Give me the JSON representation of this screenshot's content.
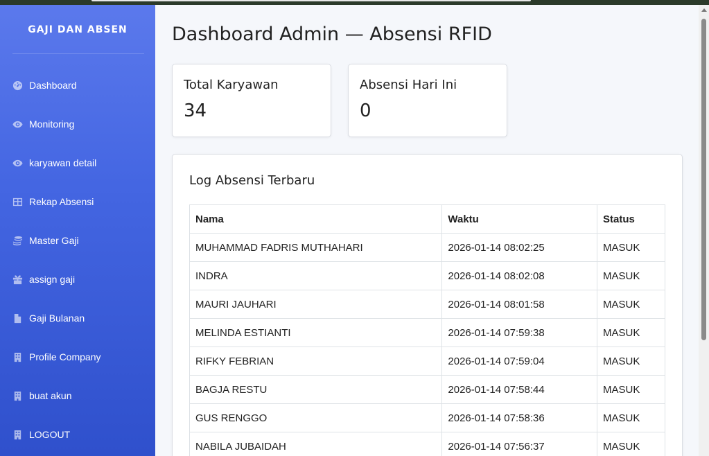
{
  "sidebar": {
    "brand": "GAJI DAN ABSEN",
    "items": [
      {
        "label": "Dashboard",
        "icon": "dashboard-icon"
      },
      {
        "label": "Monitoring",
        "icon": "eye-icon"
      },
      {
        "label": "karyawan detail",
        "icon": "eye-icon"
      },
      {
        "label": "Rekap Absensi",
        "icon": "table-icon"
      },
      {
        "label": "Master Gaji",
        "icon": "coins-icon"
      },
      {
        "label": "assign gaji",
        "icon": "gift-icon"
      },
      {
        "label": "Gaji Bulanan",
        "icon": "file-icon"
      },
      {
        "label": "Profile Company",
        "icon": "building-icon"
      },
      {
        "label": "buat akun",
        "icon": "building-icon"
      },
      {
        "label": "LOGOUT",
        "icon": "building-icon"
      }
    ]
  },
  "main": {
    "title": "Dashboard Admin — Absensi RFID",
    "stats": [
      {
        "label": "Total Karyawan",
        "value": "34"
      },
      {
        "label": "Absensi Hari Ini",
        "value": "0"
      }
    ],
    "log": {
      "title": "Log Absensi Terbaru",
      "columns": [
        "Nama",
        "Waktu",
        "Status"
      ],
      "rows": [
        [
          "MUHAMMAD FADRIS MUTHAHARI",
          "2026-01-14 08:02:25",
          "MASUK"
        ],
        [
          "INDRA",
          "2026-01-14 08:02:08",
          "MASUK"
        ],
        [
          "MAURI JAUHARI",
          "2026-01-14 08:01:58",
          "MASUK"
        ],
        [
          "MELINDA ESTIANTI",
          "2026-01-14 07:59:38",
          "MASUK"
        ],
        [
          "RIFKY FEBRIAN",
          "2026-01-14 07:59:04",
          "MASUK"
        ],
        [
          "BAGJA RESTU",
          "2026-01-14 07:58:44",
          "MASUK"
        ],
        [
          "GUS RENGGO",
          "2026-01-14 07:58:36",
          "MASUK"
        ],
        [
          "NABILA JUBAIDAH",
          "2026-01-14 07:56:37",
          "MASUK"
        ]
      ]
    }
  }
}
